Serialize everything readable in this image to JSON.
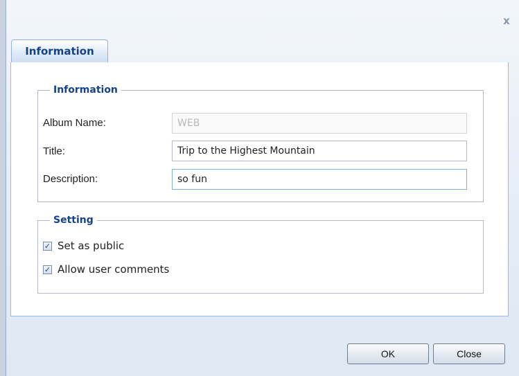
{
  "window": {
    "close_glyph": "x"
  },
  "tabs": [
    {
      "label": "Information",
      "active": true
    }
  ],
  "information": {
    "legend": "Information",
    "album_name_label": "Album Name:",
    "album_name_value": "WEB",
    "title_label": "Title:",
    "title_value": "Trip to the Highest Mountain",
    "description_label": "Description:",
    "description_value": "so fun"
  },
  "setting": {
    "legend": "Setting",
    "public_label": "Set as public",
    "public_checked": true,
    "comments_label": "Allow user comments",
    "comments_checked": true,
    "check_glyph": "✓"
  },
  "buttons": {
    "ok": "OK",
    "close": "Close"
  },
  "colors": {
    "accent": "#15428b",
    "tab_border": "#99bbe8"
  }
}
